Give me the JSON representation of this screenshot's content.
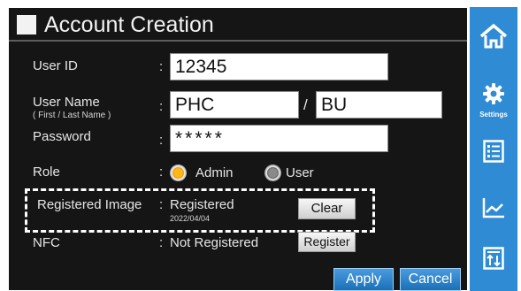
{
  "window": {
    "title": "Account Creation"
  },
  "form": {
    "user_id": {
      "label": "User ID",
      "value": "12345"
    },
    "user_name": {
      "label": "User Name",
      "sublabel": "( First / Last Name )",
      "first": "PHC",
      "separator": "/",
      "last": "BU"
    },
    "password": {
      "label": "Password",
      "value": "*****"
    },
    "role": {
      "label": "Role",
      "options": [
        "Admin",
        "User"
      ],
      "selected": "Admin"
    },
    "registered_image": {
      "label": "Registered Image",
      "status": "Registered",
      "date": "2022/04/04",
      "clear_label": "Clear"
    },
    "nfc": {
      "label": "NFC",
      "status": "Not Registered",
      "register_label": "Register"
    },
    "colon": ":"
  },
  "actions": {
    "apply_label": "Apply",
    "cancel_label": "Cancel"
  },
  "sidebar": {
    "items": [
      {
        "icon": "home-icon"
      },
      {
        "icon": "gear-icon",
        "label": "Settings"
      },
      {
        "icon": "list-icon"
      },
      {
        "icon": "line-chart-icon"
      },
      {
        "icon": "sort-icon"
      }
    ]
  },
  "colors": {
    "accent": "#2f8bd3",
    "panel": "#151515",
    "radio_selected": "#ffb619"
  }
}
